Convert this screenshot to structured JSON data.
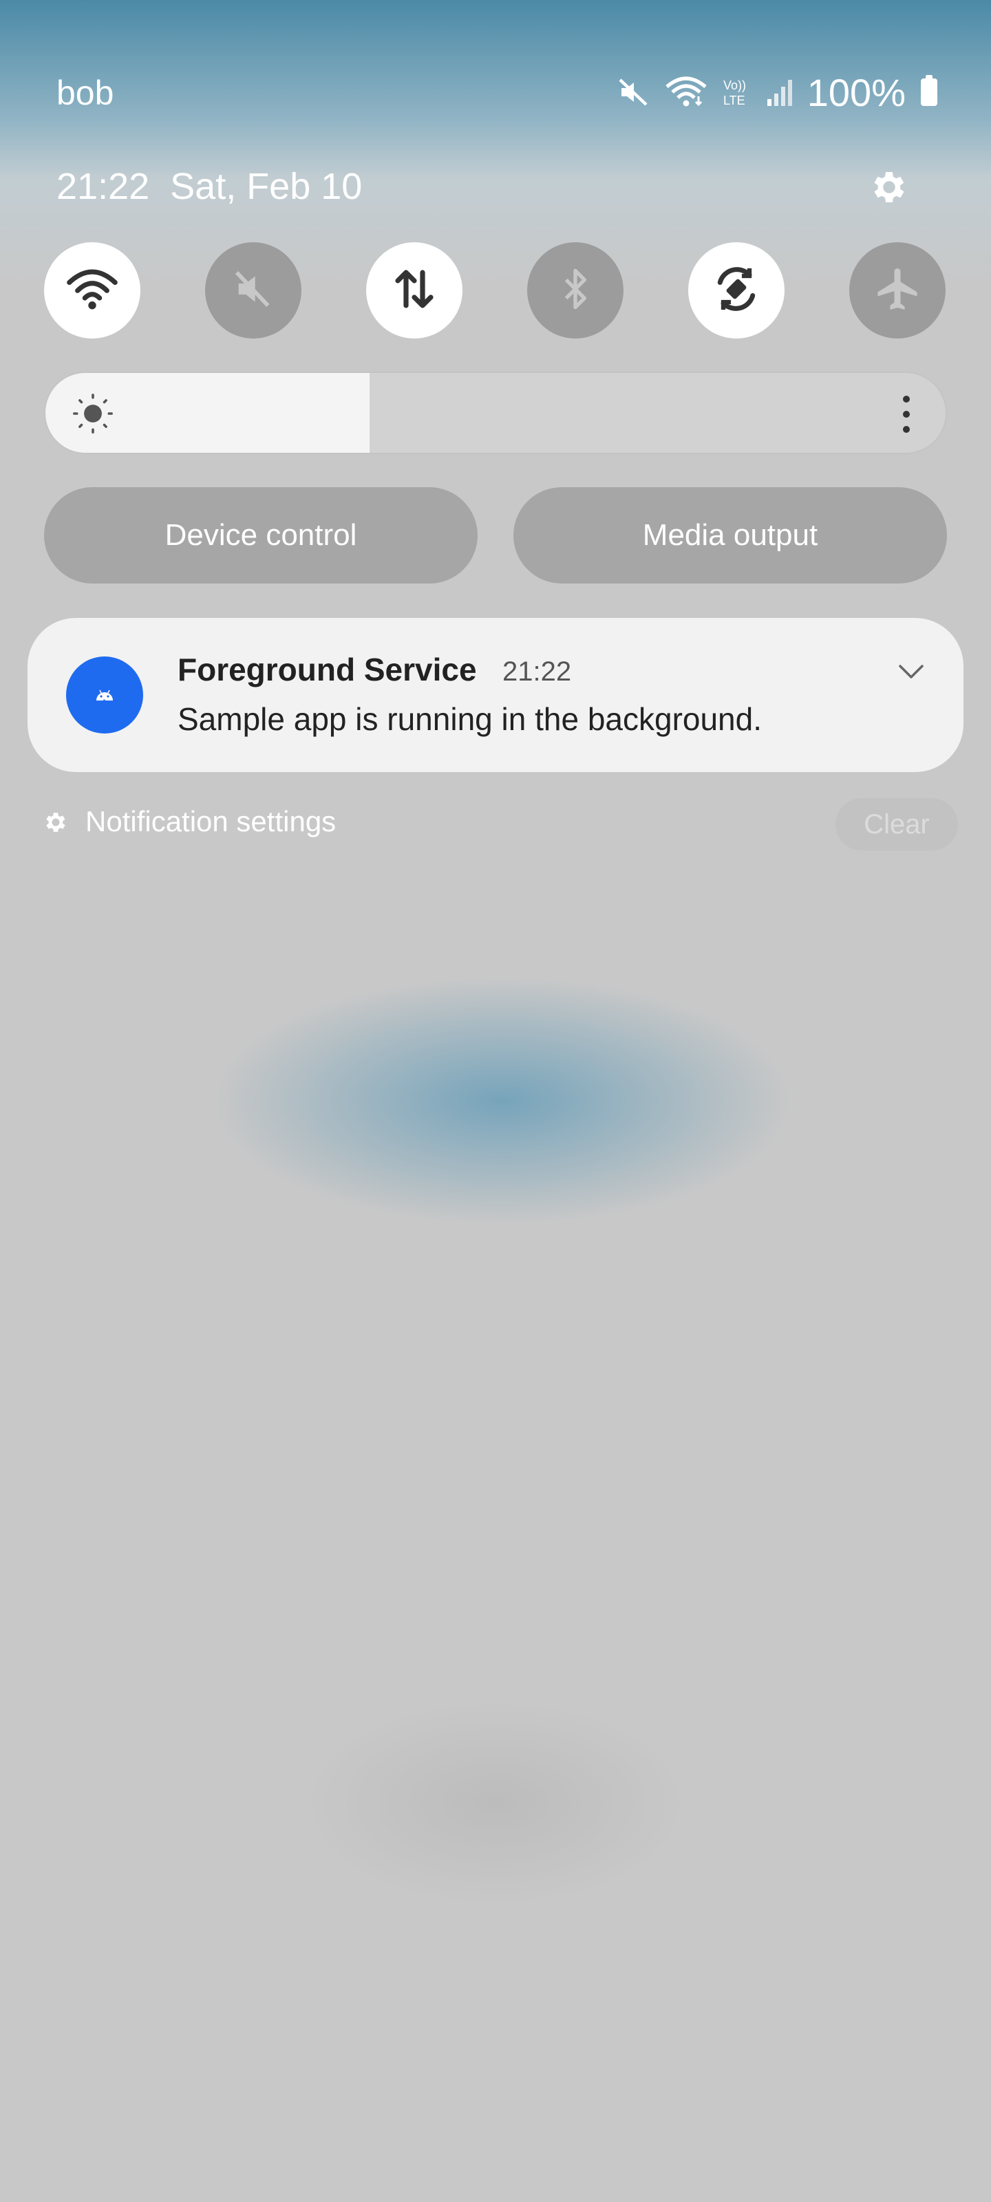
{
  "status_bar": {
    "carrier": "bob",
    "battery_percent": "100%",
    "icons": [
      "mute-icon",
      "wifi-icon",
      "volte-lte-icon",
      "signal-icon",
      "battery-icon"
    ]
  },
  "header": {
    "time": "21:22",
    "date": "Sat, Feb 10"
  },
  "quick_settings": [
    {
      "name": "wifi-icon",
      "state": "on"
    },
    {
      "name": "mute-icon",
      "state": "off"
    },
    {
      "name": "mobile-data-icon",
      "state": "on"
    },
    {
      "name": "bluetooth-icon",
      "state": "off"
    },
    {
      "name": "auto-rotate-icon",
      "state": "on"
    },
    {
      "name": "airplane-icon",
      "state": "off"
    }
  ],
  "brightness": {
    "level": 0.36
  },
  "buttons": {
    "device_control": "Device control",
    "media_output": "Media output"
  },
  "notification": {
    "title": "Foreground Service",
    "time": "21:22",
    "text": "Sample app is running in the background.",
    "icon_color": "#1f6bf0"
  },
  "footer": {
    "settings_label": "Notification settings",
    "clear_label": "Clear"
  }
}
